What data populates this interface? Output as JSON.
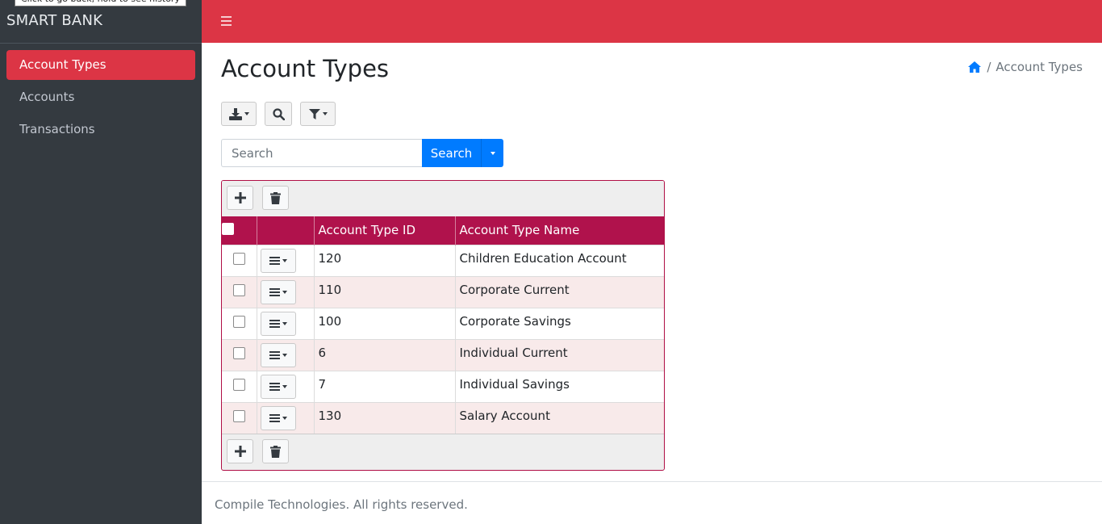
{
  "browser_tooltip": "Click to go back, hold to see history",
  "sidebar": {
    "brand": "SMART BANK",
    "items": [
      {
        "label": "Account Types",
        "active": true
      },
      {
        "label": "Accounts",
        "active": false
      },
      {
        "label": "Transactions",
        "active": false
      }
    ]
  },
  "topbar": {
    "menu_icon": "hamburger-icon"
  },
  "page": {
    "title": "Account Types",
    "breadcrumb": {
      "home_icon": "home-icon",
      "current": "Account Types"
    }
  },
  "toolbar": {
    "export_icon": "download-icon",
    "search_icon": "search-icon",
    "filter_icon": "filter-icon"
  },
  "search": {
    "placeholder": "Search",
    "value": "",
    "button_label": "Search"
  },
  "grid": {
    "add_icon": "plus-icon",
    "delete_icon": "trash-icon",
    "columns": [
      "Account Type ID",
      "Account Type Name"
    ],
    "rows": [
      {
        "id": "120",
        "name": "Children Education Account"
      },
      {
        "id": "110",
        "name": "Corporate Current"
      },
      {
        "id": "100",
        "name": "Corporate Savings"
      },
      {
        "id": "6",
        "name": "Individual Current"
      },
      {
        "id": "7",
        "name": "Individual Savings"
      },
      {
        "id": "130",
        "name": "Salary Account"
      }
    ]
  },
  "footer": {
    "text": "Compile Technologies. All rights reserved."
  },
  "colors": {
    "accent": "#dc3545",
    "sidebar": "#343a40",
    "header_row": "#b0124c",
    "primary": "#007bff"
  }
}
